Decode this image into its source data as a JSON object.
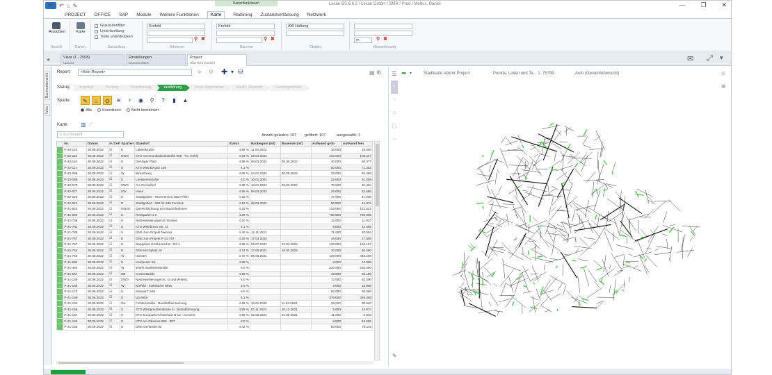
{
  "window": {
    "title": "Lexon BS 6.6.2 / Lexon GmbH / SMR / Prod / Mebus, Daniel",
    "context_tab": "Kartenfunktionen",
    "file_label": "▾",
    "controls": [
      "—",
      "❐",
      "✕"
    ]
  },
  "ribbon_tabs": [
    "PROJECT",
    "OFFICE",
    "SAP",
    "Module",
    "Weitere Funktionen",
    "Karte",
    "Redlining",
    "Zustandserfassung",
    "Netzwerk"
  ],
  "ribbon_active_tab": "Karte",
  "ribbon": {
    "groups": [
      "Ansicht",
      "Karten",
      "Darstellung",
      "Adressen",
      "Nummer",
      "Objekte",
      "Kilometrierung"
    ],
    "buttons": {
      "ansicht": "Ansichten",
      "karten": "Karte"
    },
    "checkboxes": [
      "Grausufenfilter",
      "Linienbreitung",
      "Texte unterdrücken"
    ],
    "inputs": [
      "Krefeld",
      "Krefeld",
      "AW Haftung",
      "m"
    ]
  },
  "doc_tabs": [
    {
      "title": "Vianr (1 - 2508)",
      "sub": "Ubicost"
    },
    {
      "title": "Einstellungen",
      "sub": "Benutzerdaten"
    },
    {
      "title": "Project",
      "sub": "Übersicht Gesamt"
    }
  ],
  "left_vtabs": [
    "Baumuebersicht",
    "Infos"
  ],
  "report": {
    "label": "Report:",
    "value": "<Kein Report>"
  },
  "status": {
    "label": "Status:",
    "stages": [
      "Angelegt",
      "Planung",
      "Projektierung",
      "Ausführung",
      "Techn. Abgenahme",
      "Kaufm. Abgeschl.",
      "Leistungserfasst"
    ],
    "active": "Ausführung"
  },
  "sparte": {
    "label": "Sparte:",
    "icons": [
      "✎",
      "♨",
      "⛭",
      "≋",
      "♆",
      "◉",
      "⚲",
      "?",
      "▮",
      "▲"
    ]
  },
  "filter_radios": [
    {
      "label": "Alle",
      "on": true
    },
    {
      "label": "Koordiniert",
      "on": false
    },
    {
      "label": "Nicht koordiniert",
      "on": false
    }
  ],
  "karte_label": "Karte:",
  "search": {
    "placeholder": "Suchbegriff"
  },
  "counts": {
    "loaded": "Anzahl geladen: 107",
    "found": "gefiltert: 107",
    "selected": "ausgewählt: 1"
  },
  "table": {
    "columns": [
      "Nr.",
      "Datum",
      "In SAP",
      "Sparten",
      "Standort",
      "Status",
      "Baubeginn (Ist)",
      "Bauende (Ist)",
      "Aufwand grob",
      "Aufwand fein"
    ],
    "rows": [
      [
        "P-22-124",
        "30.05.2022",
        "☑",
        "E",
        "Lakeidstraße",
        "4.95 %",
        "11.04.2022",
        "",
        "16.000",
        "15.000"
      ],
      [
        "P-22-118",
        "30.05.2022",
        "☑",
        "EWG",
        "KTS Kommunikationsstraße 888 - Fa. Hohly",
        "4.93 %",
        "29.04.2022",
        "",
        "222.000",
        "105.237"
      ],
      [
        "P-22-116",
        "30.05.2022",
        "☑",
        "E",
        "Denziger Platz",
        "4.99 %",
        "08.03.2022",
        "05.05.2022",
        "40.000",
        "60.377"
      ],
      [
        "P-22-111",
        "30.05.2022",
        "☑",
        "E",
        "KTS Weinbergstr 108",
        "4.1 %",
        "",
        "",
        "50.000",
        "71.302"
      ],
      [
        "P-22-096",
        "30.05.2022",
        "☑",
        "W",
        "Birnenburg",
        "4.85 %",
        "24.01.2022",
        "30.05.2022",
        "33.000",
        "82.458"
      ],
      [
        "P-22-089",
        "30.05.2022",
        "☑",
        "E",
        "Lessenenstraße",
        "4.0 %",
        "10.01.2022",
        "",
        "22.600",
        "31.058"
      ],
      [
        "P-22-078",
        "30.05.2022",
        "☑",
        "EWG",
        "Am Pochelhof",
        "4.99 %",
        "10.01.2022",
        "06.03.2022",
        "75.000",
        "34.404"
      ],
      [
        "P-22-077",
        "30.05.2022",
        "☑",
        "EW",
        "Haas",
        "4.96 %",
        "08.03.2022",
        "",
        "26.000",
        "22.550"
      ],
      [
        "P-22-026",
        "30.05.2022",
        "☑",
        "E",
        "Stadtgebiet - Internremies 493 Fehlst.",
        "4.10 %",
        "",
        "",
        "47.000",
        "47.000"
      ],
      [
        "P-22-021",
        "30.05.2022",
        "☑",
        "E",
        "Stadtgebiet - 098 für 685 Familien",
        "4.10 %",
        "28.03.2022",
        "",
        "50.000",
        "44.875"
      ],
      [
        "P-21-820",
        "30.05.2022",
        "☑",
        "EWGF",
        "Querschlichtung von Bauhofnahmen",
        "4.20 %",
        "",
        "",
        "133.000",
        "121.622"
      ],
      [
        "P-21-800",
        "30.05.2022",
        "☑",
        "E",
        "Redoparch 1.0",
        "4.20 %",
        "",
        "",
        "780.000",
        "780.000"
      ],
      [
        "P-21-799",
        "30.05.2022",
        "☑",
        "E",
        "Netzerweiterungen E Strasse",
        "4.10 %",
        "",
        "",
        "12.000",
        "11.027"
      ],
      [
        "P-21-781",
        "30.05.2022",
        "☑",
        "E",
        "KTS Weinbuner Str. 11",
        "4.1 %",
        "",
        "",
        "8.000",
        "11.605"
      ],
      [
        "P-21-780",
        "30.05.2022",
        "☑",
        "E",
        "DNS zum Projekt Nienalo",
        "4.40 %",
        "12.11.2021",
        "",
        "71.000",
        "20.553"
      ],
      [
        "P-21-767",
        "30.05.2022",
        "☑",
        "E",
        "DNS zum Projekt P-21-757",
        "4.20 %",
        "17.03.2022",
        "",
        "34.000",
        "27.585"
      ],
      [
        "P-21-757",
        "30.05.2022",
        "☑",
        "E",
        "Baugebiet Großmannhm. Teil 1",
        "4.99 %",
        "09.07.2021",
        "12.04.2022",
        "125.000",
        "125.187"
      ],
      [
        "P-21-754",
        "30.05.2022",
        "☑",
        "E",
        "DNS Kirchplatz 10",
        "4.74 %",
        "17.09.2021",
        "18.02.2022",
        "10.000",
        "66.260"
      ],
      [
        "P-21-750",
        "30.05.2022",
        "☑",
        "W",
        "Hansen",
        "4.70 %",
        "06.09.2021",
        "",
        "429.000",
        "448.206"
      ],
      [
        "P-21-690",
        "30.05.2022",
        "☑",
        "E",
        "Kempener Str.",
        "4.99 %",
        "",
        "",
        "8.000",
        "14.000"
      ],
      [
        "P-21-460",
        "30.05.2022",
        "☑",
        "W",
        "WWG Stahlwerkstraße",
        "4.0 %",
        "",
        "",
        "220.000",
        "220.000"
      ],
      [
        "P-21-667",
        "30.05.2022",
        "☑",
        "EB",
        "Krosenstraße",
        "4.99 %",
        "",
        "",
        "46.000",
        "56.108"
      ],
      [
        "P-21-189",
        "30.05.2022",
        "☑",
        "EWG",
        "Netzerweiterungen E, G und W-Netz",
        "4.0 %",
        "",
        "",
        "72.000",
        "82.000"
      ],
      [
        "P-21-188",
        "30.05.2022",
        "☑",
        "W",
        "Krefeld - mehrfache WNS",
        "4.0 %",
        "",
        "",
        "8.000",
        "13.000"
      ],
      [
        "P-21-172",
        "30.05.2022",
        "☑",
        "E",
        "ManoerT SIM",
        "4.0 %",
        "",
        "",
        "50.000",
        "50.000"
      ],
      [
        "P-21-166",
        "30.05.2022",
        "☑",
        "E",
        "Up Mitte",
        "4.1 %",
        "",
        "",
        "376.000",
        "316.000"
      ],
      [
        "P-21-162",
        "30.05.2022",
        "☑",
        "Ew",
        "Fichtenstraße - Baufeldfreimachung",
        "4.98 %",
        "10.01.2022",
        "11.03.2022",
        "25.000",
        "30.640"
      ],
      [
        "P-21-158",
        "30.05.2022",
        "☑",
        "E",
        "KTS Westpreußenstraße 4 - Netzabtrennung",
        "4.99 %",
        "02.11.2021",
        "10.12.2021",
        "5.000",
        "12.974"
      ],
      [
        "P-21-157",
        "30.05.2022",
        "☑",
        "E",
        "KTS Europark Fichtenhain B 12 - Kunzent",
        "4.95 %",
        "02.08.2021",
        "04.08.2021",
        "11.000",
        "8.835"
      ],
      [
        "P-21-156",
        "30.05.2022",
        "☑",
        "E",
        "KTS Am Obsenet 999 - 857",
        "4.0 %",
        "",
        "",
        "8.000",
        "63.565"
      ],
      [
        "P-21-155",
        "30.05.2022",
        "☑",
        "E",
        "DNS Gerlandie 62",
        "4.42 %",
        "",
        "",
        "60.000",
        "79.116"
      ]
    ]
  },
  "map": {
    "title": "Stadtkarte Vektor Project",
    "layer": "Punkte, Linien und Te... 1: 75799",
    "mode": "Auto (Gesamtübersicht)"
  },
  "progress": 0.05,
  "colors": {
    "accent": "#2e9e4a",
    "stage_active": "#2e9e4a",
    "row_marker": "#6fc36f",
    "brand": "#2b6fbd"
  }
}
